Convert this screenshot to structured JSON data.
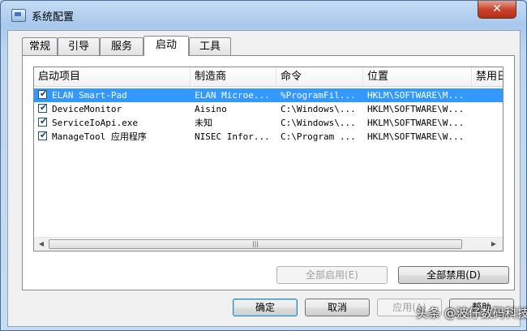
{
  "window": {
    "title": "系统配置",
    "close_glyph": "✕"
  },
  "tabs": [
    {
      "label": "常规",
      "active": false
    },
    {
      "label": "引导",
      "active": false
    },
    {
      "label": "服务",
      "active": false
    },
    {
      "label": "启动",
      "active": true
    },
    {
      "label": "工具",
      "active": false
    }
  ],
  "startup_table": {
    "columns": [
      "启动项目",
      "制造商",
      "命令",
      "位置",
      "禁用日"
    ],
    "rows": [
      {
        "checked": true,
        "selected": true,
        "item": "ELAN Smart-Pad",
        "maker": "ELAN Microe...",
        "command": "%ProgramFil...",
        "location": "HKLM\\SOFTWARE\\M..."
      },
      {
        "checked": true,
        "selected": false,
        "item": "DeviceMonitor",
        "maker": "Aisino",
        "command": "C:\\Windows\\...",
        "location": "HKLM\\SOFTWARE\\W..."
      },
      {
        "checked": true,
        "selected": false,
        "item": "ServiceIoApi.exe",
        "maker": "未知",
        "command": "C:\\Windows\\...",
        "location": "HKLM\\SOFTWARE\\W..."
      },
      {
        "checked": true,
        "selected": false,
        "item": "ManageTool 应用程序",
        "maker": "NISEC Infor...",
        "command": "C:\\Program ...",
        "location": "HKLM\\SOFTWARE\\W..."
      }
    ],
    "scroll_left_glyph": "◀",
    "scroll_right_glyph": "▶",
    "scroll_grip": "|||"
  },
  "panel_buttons": {
    "enable_all": "全部启用(E)",
    "disable_all": "全部禁用(D)"
  },
  "dialog_buttons": {
    "ok": "确定",
    "cancel": "取消",
    "apply": "应用(A)",
    "help": "帮助"
  },
  "watermark": "头条 @波仔数码科技"
}
